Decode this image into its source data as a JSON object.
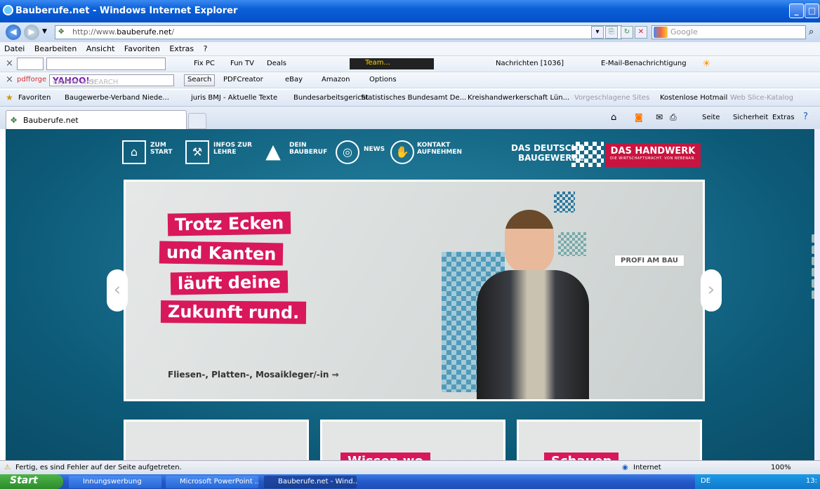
{
  "window": {
    "title": "Bauberufe.net - Windows Internet Explorer"
  },
  "address": {
    "prefix": "http://www.",
    "domain": "bauberufe.net",
    "suffix": "/"
  },
  "search_box": {
    "placeholder": "Google"
  },
  "menu": [
    "Datei",
    "Bearbeiten",
    "Ansicht",
    "Favoriten",
    "Extras",
    "?"
  ],
  "toolbar1": {
    "items": [
      "Fix PC",
      "Fun TV",
      "Deals",
      "Team...",
      "Nachrichten [1036]",
      "E-Mail-Benachrichtigung"
    ]
  },
  "toolbar2": {
    "pdfforge": "pdfforge",
    "yahoo_hint": "explore with",
    "yahoo_brand": "YAHOO!",
    "yahoo_search": "SEARCH",
    "search_btn": "Search",
    "items": [
      "PDFCreator",
      "eBay",
      "Amazon",
      "Options"
    ]
  },
  "favorites": {
    "label": "Favoriten",
    "items": [
      "Baugewerbe-Verband Niede...",
      "juris BMJ - Aktuelle Texte",
      "Bundesarbeitsgericht",
      "Statistisches Bundesamt De...",
      "Kreishandwerkerschaft Lün...",
      "Vorgeschlagene Sites",
      "Kostenlose Hotmail",
      "Web Slice-Katalog"
    ]
  },
  "tab": {
    "title": "Bauberufe.net"
  },
  "tab_tools": [
    "Seite",
    "Sicherheit",
    "Extras"
  ],
  "site_nav": [
    {
      "line1": "ZUM",
      "line2": "START",
      "icon": "home-icon"
    },
    {
      "line1": "INFOS ZUR",
      "line2": "LEHRE",
      "icon": "tool-icon"
    },
    {
      "line1": "DEIN",
      "line2": "BAUBERUF",
      "icon": "workers-icon"
    },
    {
      "line1": "NEWS",
      "line2": "",
      "icon": "globe-icon"
    },
    {
      "line1": "KONTAKT",
      "line2": "AUFNEHMEN",
      "icon": "handshake-icon"
    }
  ],
  "brand": {
    "line1": "DAS DEUTSCHE",
    "line2": "BAUGEWERBE",
    "handwerk": "DAS HANDWERK",
    "handwerk_sub": "DIE WIRTSCHAFTSMACHT. VON NEBENAN."
  },
  "hero": {
    "slogan": [
      "Trotz Ecken",
      "und Kanten",
      "läuft deine",
      "Zukunft rund."
    ],
    "badge": "PROFI AM BAU",
    "caption": "Fliesen-, Platten-, Mosaikleger/-in ⇒"
  },
  "tiles": {
    "tile2_text": "Wissen wo",
    "tile3_text": "Schauen"
  },
  "status": {
    "text": "Fertig, es sind Fehler auf der Seite aufgetreten.",
    "zone": "Internet",
    "zoom": "100%"
  },
  "taskbar": {
    "start": "Start",
    "tasks": [
      "Innungswerbung",
      "Microsoft PowerPoint ...",
      "Bauberufe.net - Wind..."
    ],
    "lang": "DE",
    "clock": "13:"
  },
  "colors": {
    "accent_pink": "#d8185a",
    "handwerk_red": "#c9143f",
    "page_teal": "#0c5a78"
  }
}
